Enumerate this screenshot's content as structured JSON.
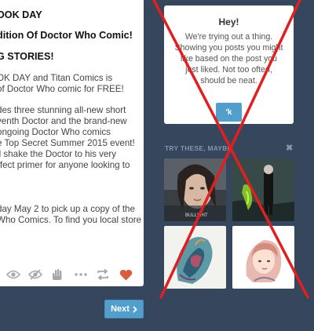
{
  "post": {
    "lines": [
      "OOK DAY",
      "dition Of Doctor Who Comic!",
      "G STORIES!",
      "OK DAY and Titan Comics is",
      "of Doctor Who comic for FREE!",
      "des three stunning all-new short",
      "venth Doctor and the brand-new",
      "ongoing Doctor Who comics",
      "e Top Secret Summer 2015 event!",
      "ll shake the Doctor to his very",
      "rfect primer for anyone looking to",
      "day May 2 to pick up a copy of the",
      "Who Comics. To find you local store"
    ],
    "colors": {
      "heart": "#d95e40",
      "action": "#a7a7a7"
    },
    "actions": [
      "eye-icon",
      "eye-slash-icon",
      "hand-icon",
      "more-icon",
      "reblog-icon",
      "heart-icon"
    ]
  },
  "navigation": {
    "next_label": "Next"
  },
  "hey_popup": {
    "title": "Hey!",
    "body_lines": [
      "We're trying out a thing.",
      "Showing you posts you might",
      "like based on the post you",
      "just liked. Not too often,",
      "should be neat."
    ],
    "button_label": "'k"
  },
  "suggestions": {
    "title": "TRY THESE, MAYBE",
    "close_glyph": "✖",
    "thumb_caption": "BULLSHIT"
  },
  "colors": {
    "background": "#36465d",
    "accent": "#529ecc",
    "cross": "#e02020"
  }
}
